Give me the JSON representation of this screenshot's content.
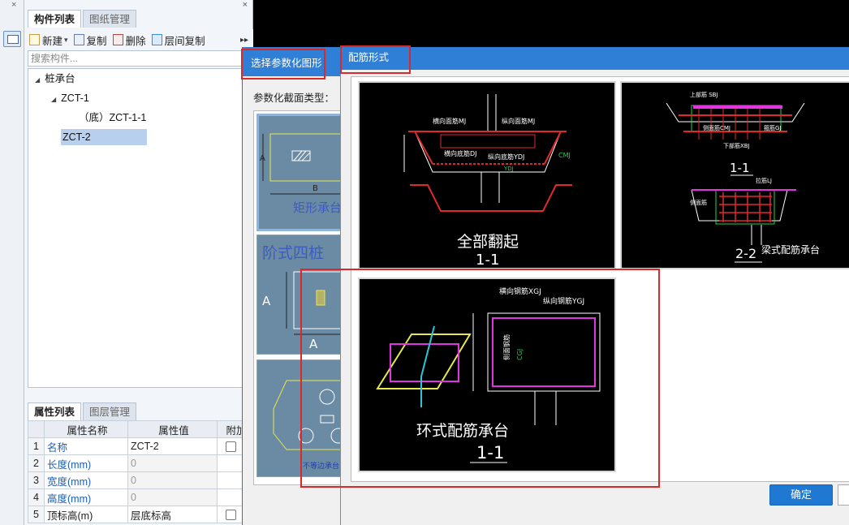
{
  "left_panel": {
    "tabs": [
      "构件列表",
      "图纸管理"
    ],
    "toolbar": {
      "new_label": "新建",
      "copy_label": "复制",
      "delete_label": "删除",
      "layer_copy_label": "层间复制"
    },
    "search_placeholder": "搜索构件...",
    "tree": {
      "root": "桩承台",
      "child1": "ZCT-1",
      "child1_sub": "（底）ZCT-1-1",
      "child2": "ZCT-2"
    },
    "props_tabs": [
      "属性列表",
      "图层管理"
    ],
    "props_header": [
      "属性名称",
      "属性值",
      "附加"
    ],
    "props_rows": [
      {
        "num": "1",
        "name": "名称",
        "value": "ZCT-2"
      },
      {
        "num": "2",
        "name": "长度(mm)",
        "value": "0"
      },
      {
        "num": "3",
        "name": "宽度(mm)",
        "value": "0"
      },
      {
        "num": "4",
        "name": "高度(mm)",
        "value": "0"
      },
      {
        "num": "5",
        "name": "顶标高(m)",
        "value": "层底标高"
      }
    ]
  },
  "dialog_shape": {
    "title": "选择参数化图形",
    "section_label": "参数化截面类型：",
    "shapes": [
      {
        "caption": "矩形承台",
        "dim_a": "A",
        "dim_b": "B"
      },
      {
        "caption": "阶式四桩",
        "dim_a": "A"
      },
      {
        "caption": "不等边承台"
      }
    ]
  },
  "dialog_rebar": {
    "title": "配筋形式",
    "confirm_label": "确定",
    "options": [
      {
        "caption": "全部翻起",
        "section": "1-1",
        "labels": [
          "横向面筋MJ",
          "纵向面筋MJ",
          "横向底筋DJ",
          "纵向底筋YDJ",
          "CMJ",
          "YDJ"
        ]
      },
      {
        "caption": "梁式配筋承台",
        "section1": "1-1",
        "section2": "2-2",
        "labels": [
          "上部筋 SBJ",
          "侧面筋CMJ",
          "下部筋XBJ",
          "箍筋GJ",
          "侧面筋",
          "拉筋LJ"
        ]
      },
      {
        "caption": "环式配筋承台",
        "section": "1-1",
        "labels": [
          "横向钢筋XGJ",
          "纵向钢筋YGJ",
          "侧面钢筋",
          "CGJ"
        ]
      }
    ]
  }
}
